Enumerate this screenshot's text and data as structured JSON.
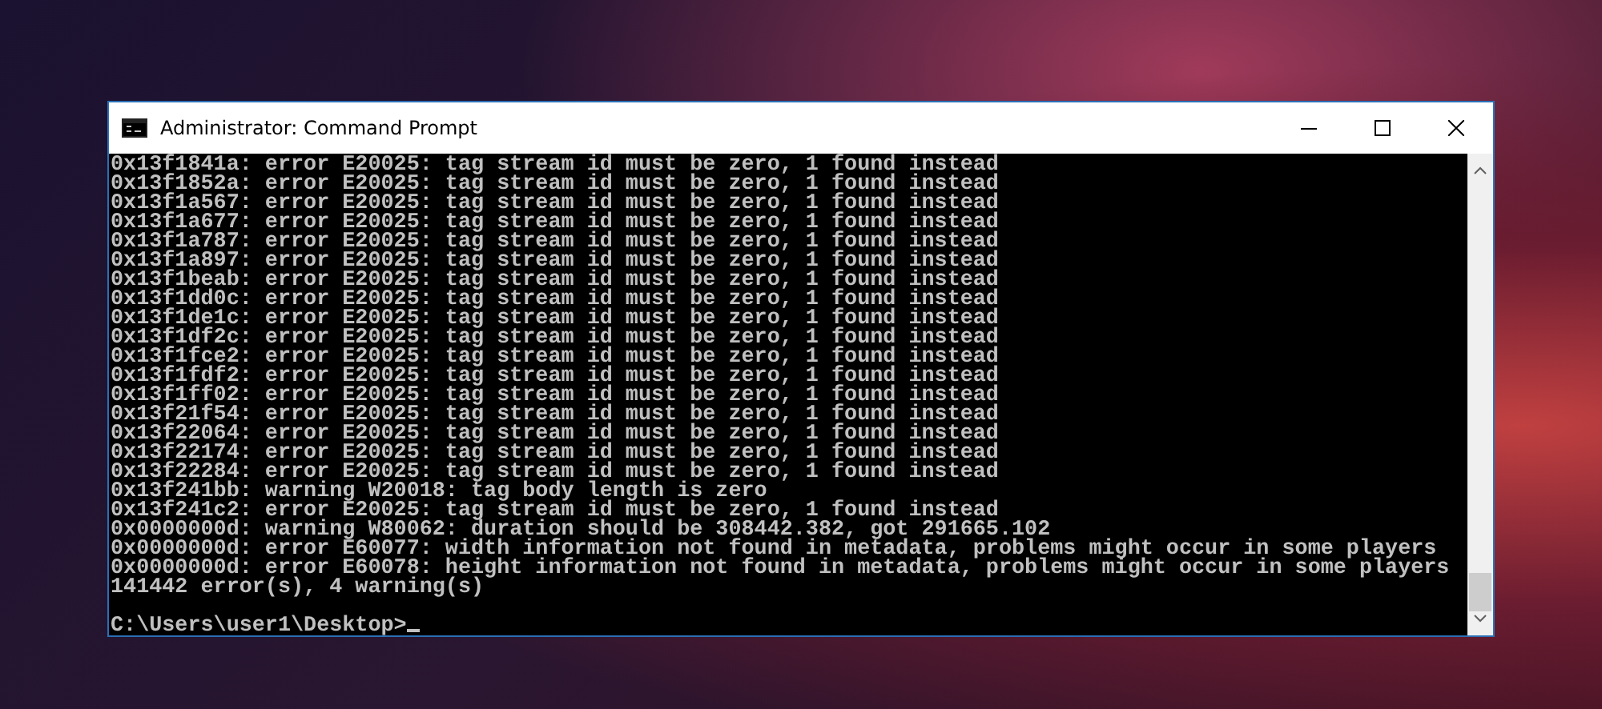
{
  "window": {
    "title": "Administrator: Command Prompt"
  },
  "console": {
    "lines": [
      "0x13f1841a: error E20025: tag stream id must be zero, 1 found instead",
      "0x13f1852a: error E20025: tag stream id must be zero, 1 found instead",
      "0x13f1a567: error E20025: tag stream id must be zero, 1 found instead",
      "0x13f1a677: error E20025: tag stream id must be zero, 1 found instead",
      "0x13f1a787: error E20025: tag stream id must be zero, 1 found instead",
      "0x13f1a897: error E20025: tag stream id must be zero, 1 found instead",
      "0x13f1beab: error E20025: tag stream id must be zero, 1 found instead",
      "0x13f1dd0c: error E20025: tag stream id must be zero, 1 found instead",
      "0x13f1de1c: error E20025: tag stream id must be zero, 1 found instead",
      "0x13f1df2c: error E20025: tag stream id must be zero, 1 found instead",
      "0x13f1fce2: error E20025: tag stream id must be zero, 1 found instead",
      "0x13f1fdf2: error E20025: tag stream id must be zero, 1 found instead",
      "0x13f1ff02: error E20025: tag stream id must be zero, 1 found instead",
      "0x13f21f54: error E20025: tag stream id must be zero, 1 found instead",
      "0x13f22064: error E20025: tag stream id must be zero, 1 found instead",
      "0x13f22174: error E20025: tag stream id must be zero, 1 found instead",
      "0x13f22284: error E20025: tag stream id must be zero, 1 found instead",
      "0x13f241bb: warning W20018: tag body length is zero",
      "0x13f241c2: error E20025: tag stream id must be zero, 1 found instead",
      "0x0000000d: warning W80062: duration should be 308442.382, got 291665.102",
      "0x0000000d: error E60077: width information not found in metadata, problems might occur in some players",
      "0x0000000d: error E60078: height information not found in metadata, problems might occur in some players",
      "141442 error(s), 4 warning(s)"
    ],
    "prompt": "C:\\Users\\user1\\Desktop>"
  }
}
